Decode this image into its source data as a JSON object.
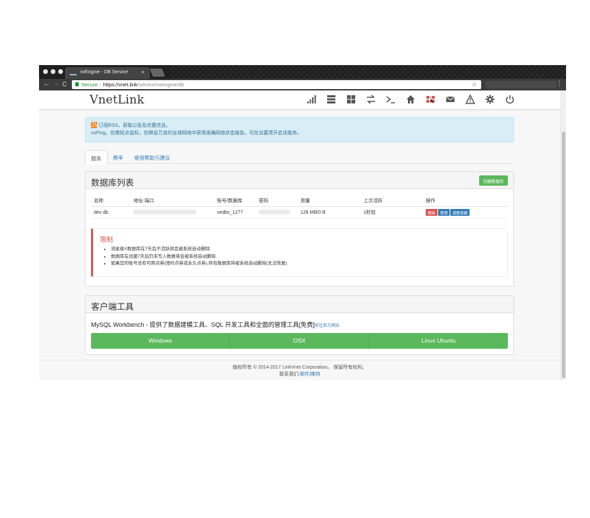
{
  "browser": {
    "tab_title": "vxEngine - DB Service",
    "tab_close": "×",
    "url_secure": "Secure",
    "url_host": "https://vnet.link",
    "url_path": "/service/vxengine/db",
    "star": "☆",
    "menu": "⋮",
    "back": "←",
    "forward": "→",
    "reload": "C"
  },
  "header": {
    "logo": "VnetLink",
    "nav_icons": [
      "signal-icon",
      "server-icon",
      "grid-icon",
      "transfer-icon",
      "terminal-icon",
      "home-icon",
      "database-icon",
      "mail-icon",
      "warning-icon",
      "gear-icon",
      "power-icon"
    ]
  },
  "alert": {
    "line1": "订阅RSS，获取公告及优惠信息。",
    "line2": "vxPing，仅需轻点鼠标，在瞬息万变的全球网络中获得准确网络状态报告，可在设置项开启该服务。"
  },
  "tabs": [
    "服务",
    "费率",
    "使用帮助与建议"
  ],
  "db_panel": {
    "title": "数据库列表",
    "create_button": "创建数据库",
    "columns": [
      "名称",
      "地址:端口",
      "账号/数据库",
      "密码",
      "用量",
      "上次活跃",
      "操作"
    ],
    "rows": [
      {
        "name": "dev db",
        "account": "vedbs_1277",
        "usage": "128 MB/0 B",
        "last_active": "1秒前",
        "actions": [
          "删除",
          "管理",
          "调整规模"
        ]
      }
    ],
    "limits_title": "限制",
    "limits": [
      "流星级X数据库在7天后不活跃将会被系统自动删除.",
      "数据库在创建7天后仍未写入数据将会被系统自动删除.",
      "如果您的账号没有可用点券(限时点券或永久点券),所有数据库将被系统自动删除(无法恢复)."
    ]
  },
  "client_panel": {
    "title": "客户端工具",
    "description": "MySQL Workbench - 提供了数据建模工具、SQL 开发工具和全面的管理工具[免费]",
    "link": "前往官方网站",
    "downloads": [
      "Windows",
      "OSX",
      "Linux Ubuntu"
    ]
  },
  "footer": {
    "copyright": "版权所有 © 2014-2017 LinkVnet Corporation。 保留所有权利。",
    "contact_prefix": "联系我们:",
    "contact_mail": "邮件",
    "contact_sep": "|",
    "contact_tweet": "推特"
  },
  "colors": {
    "primary": "#337ab7",
    "success": "#5cb85c",
    "danger": "#d9534f",
    "info_bg": "#d9edf7"
  }
}
